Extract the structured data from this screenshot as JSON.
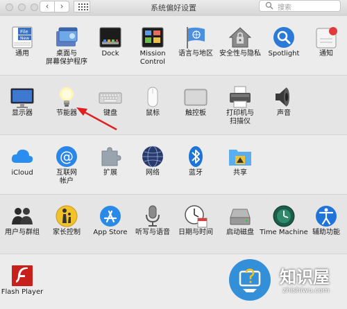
{
  "window": {
    "title": "系统偏好设置",
    "nav_back": "‹",
    "nav_forward": "›",
    "search_placeholder": "搜索"
  },
  "rows": [
    {
      "items": [
        {
          "id": "general",
          "label": "通用",
          "icon": "general-icon"
        },
        {
          "id": "desktop",
          "label": "桌面与",
          "label2": "屏幕保护程序",
          "icon": "desktop-screensaver-icon"
        },
        {
          "id": "dock",
          "label": "Dock",
          "icon": "dock-icon"
        },
        {
          "id": "mission",
          "label": "Mission",
          "label2": "Control",
          "icon": "mission-control-icon"
        },
        {
          "id": "language",
          "label": "语言与地区",
          "icon": "un-flag-icon"
        },
        {
          "id": "security",
          "label": "安全性与隐私",
          "icon": "house-lock-icon"
        },
        {
          "id": "spotlight",
          "label": "Spotlight",
          "icon": "spotlight-icon"
        },
        {
          "id": "notifications",
          "label": "通知",
          "icon": "notifications-icon"
        }
      ]
    },
    {
      "items": [
        {
          "id": "displays",
          "label": "显示器",
          "icon": "display-icon"
        },
        {
          "id": "energy",
          "label": "节能器",
          "icon": "lightbulb-icon"
        },
        {
          "id": "keyboard",
          "label": "键盘",
          "icon": "keyboard-icon"
        },
        {
          "id": "mouse",
          "label": "鼠标",
          "icon": "mouse-icon"
        },
        {
          "id": "trackpad",
          "label": "触控板",
          "icon": "trackpad-icon"
        },
        {
          "id": "printers",
          "label": "打印机与",
          "label2": "扫描仪",
          "icon": "printer-icon"
        },
        {
          "id": "sound",
          "label": "声音",
          "icon": "speaker-icon"
        }
      ]
    },
    {
      "items": [
        {
          "id": "icloud",
          "label": "iCloud",
          "icon": "icloud-icon"
        },
        {
          "id": "internet",
          "label": "互联网",
          "label2": "帐户",
          "icon": "at-sign-icon"
        },
        {
          "id": "extensions",
          "label": "扩展",
          "icon": "puzzle-icon"
        },
        {
          "id": "network",
          "label": "网络",
          "icon": "globe-icon"
        },
        {
          "id": "bluetooth",
          "label": "蓝牙",
          "icon": "bluetooth-icon"
        },
        {
          "id": "sharing",
          "label": "共享",
          "icon": "sharing-folder-icon"
        }
      ]
    },
    {
      "items": [
        {
          "id": "users",
          "label": "用户与群组",
          "icon": "users-icon"
        },
        {
          "id": "parental",
          "label": "家长控制",
          "icon": "parental-controls-icon"
        },
        {
          "id": "appstore",
          "label": "App Store",
          "icon": "app-store-icon"
        },
        {
          "id": "dictation",
          "label": "听写与语音",
          "icon": "microphone-icon"
        },
        {
          "id": "datetime",
          "label": "日期与时间",
          "icon": "clock-calendar-icon"
        },
        {
          "id": "startup",
          "label": "启动磁盘",
          "icon": "hard-disk-icon"
        },
        {
          "id": "timemachine",
          "label": "Time Machine",
          "icon": "time-machine-icon"
        },
        {
          "id": "accessibility",
          "label": "辅助功能",
          "icon": "accessibility-icon"
        }
      ]
    },
    {
      "items": [
        {
          "id": "flash",
          "label": "Flash Player",
          "icon": "flash-player-icon"
        }
      ]
    }
  ],
  "annotation": {
    "color": "#e02020",
    "target": "节能器"
  },
  "watermark": {
    "text": "知识屋",
    "url": "zhishiwu.com"
  }
}
